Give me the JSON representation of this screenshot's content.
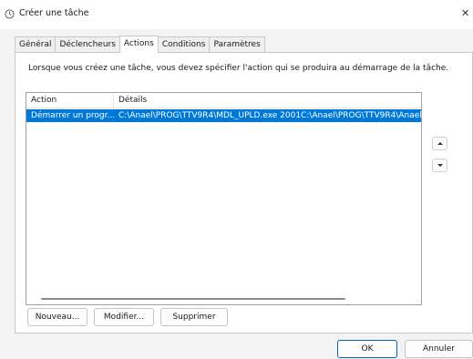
{
  "window": {
    "title": "Créer une tâche",
    "close_label": "✕"
  },
  "tabs": [
    {
      "label": "Général",
      "active": false
    },
    {
      "label": "Déclencheurs",
      "active": false
    },
    {
      "label": "Actions",
      "active": true
    },
    {
      "label": "Conditions",
      "active": false
    },
    {
      "label": "Paramètres",
      "active": false
    }
  ],
  "actions_panel": {
    "description": "Lorsque vous créez une tâche, vous devez spécifier l'action qui se produira au démarrage de la tâche.",
    "columns": [
      "Action",
      "Détails"
    ],
    "rows": [
      {
        "action": "Démarrer un progr...",
        "details": "C:\\Anael\\PROG\\TTV9R4\\MDL_UPLD.exe 2001C:\\Anael\\PROG\\TTV9R4\\Anael",
        "selected": true
      }
    ],
    "buttons": {
      "new": "Nouveau...",
      "edit": "Modifier...",
      "delete": "Supprimer"
    }
  },
  "footer": {
    "ok": "OK",
    "cancel": "Annuler"
  },
  "colors": {
    "selection": "#0078d7",
    "accent": "#0067c0"
  },
  "icons": {
    "title": "task-clock-icon",
    "move_up": "arrow-up-icon",
    "move_down": "arrow-down-icon"
  }
}
